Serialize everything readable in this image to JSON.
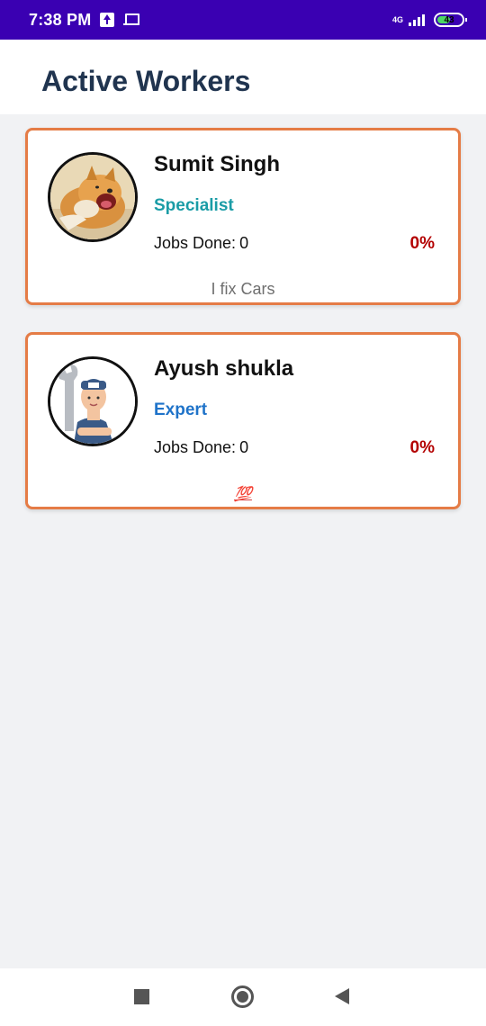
{
  "status_bar": {
    "time": "7:38 PM",
    "network": "4G",
    "battery": "43"
  },
  "header": {
    "title": "Active Workers"
  },
  "workers": [
    {
      "name": "Sumit Singh",
      "rank": "Specialist",
      "rank_color": "#1a9ca6",
      "jobs_label": "Jobs Done:",
      "jobs_count": "0",
      "rate": "0%",
      "bio": "I fix Cars",
      "avatar": "dog-photo"
    },
    {
      "name": "Ayush shukla",
      "rank": "Expert",
      "rank_color": "#1f73c9",
      "jobs_label": "Jobs Done:",
      "jobs_count": "0",
      "rate": "0%",
      "bio": "💯",
      "avatar": "mechanic-illustration"
    }
  ],
  "colors": {
    "status_bar": "#3a00b2",
    "title": "#20344f",
    "card_border": "#e57c46",
    "rate": "#b30000"
  },
  "nav_bar": {
    "icons": [
      "recent-apps-icon",
      "home-icon",
      "back-icon"
    ]
  }
}
